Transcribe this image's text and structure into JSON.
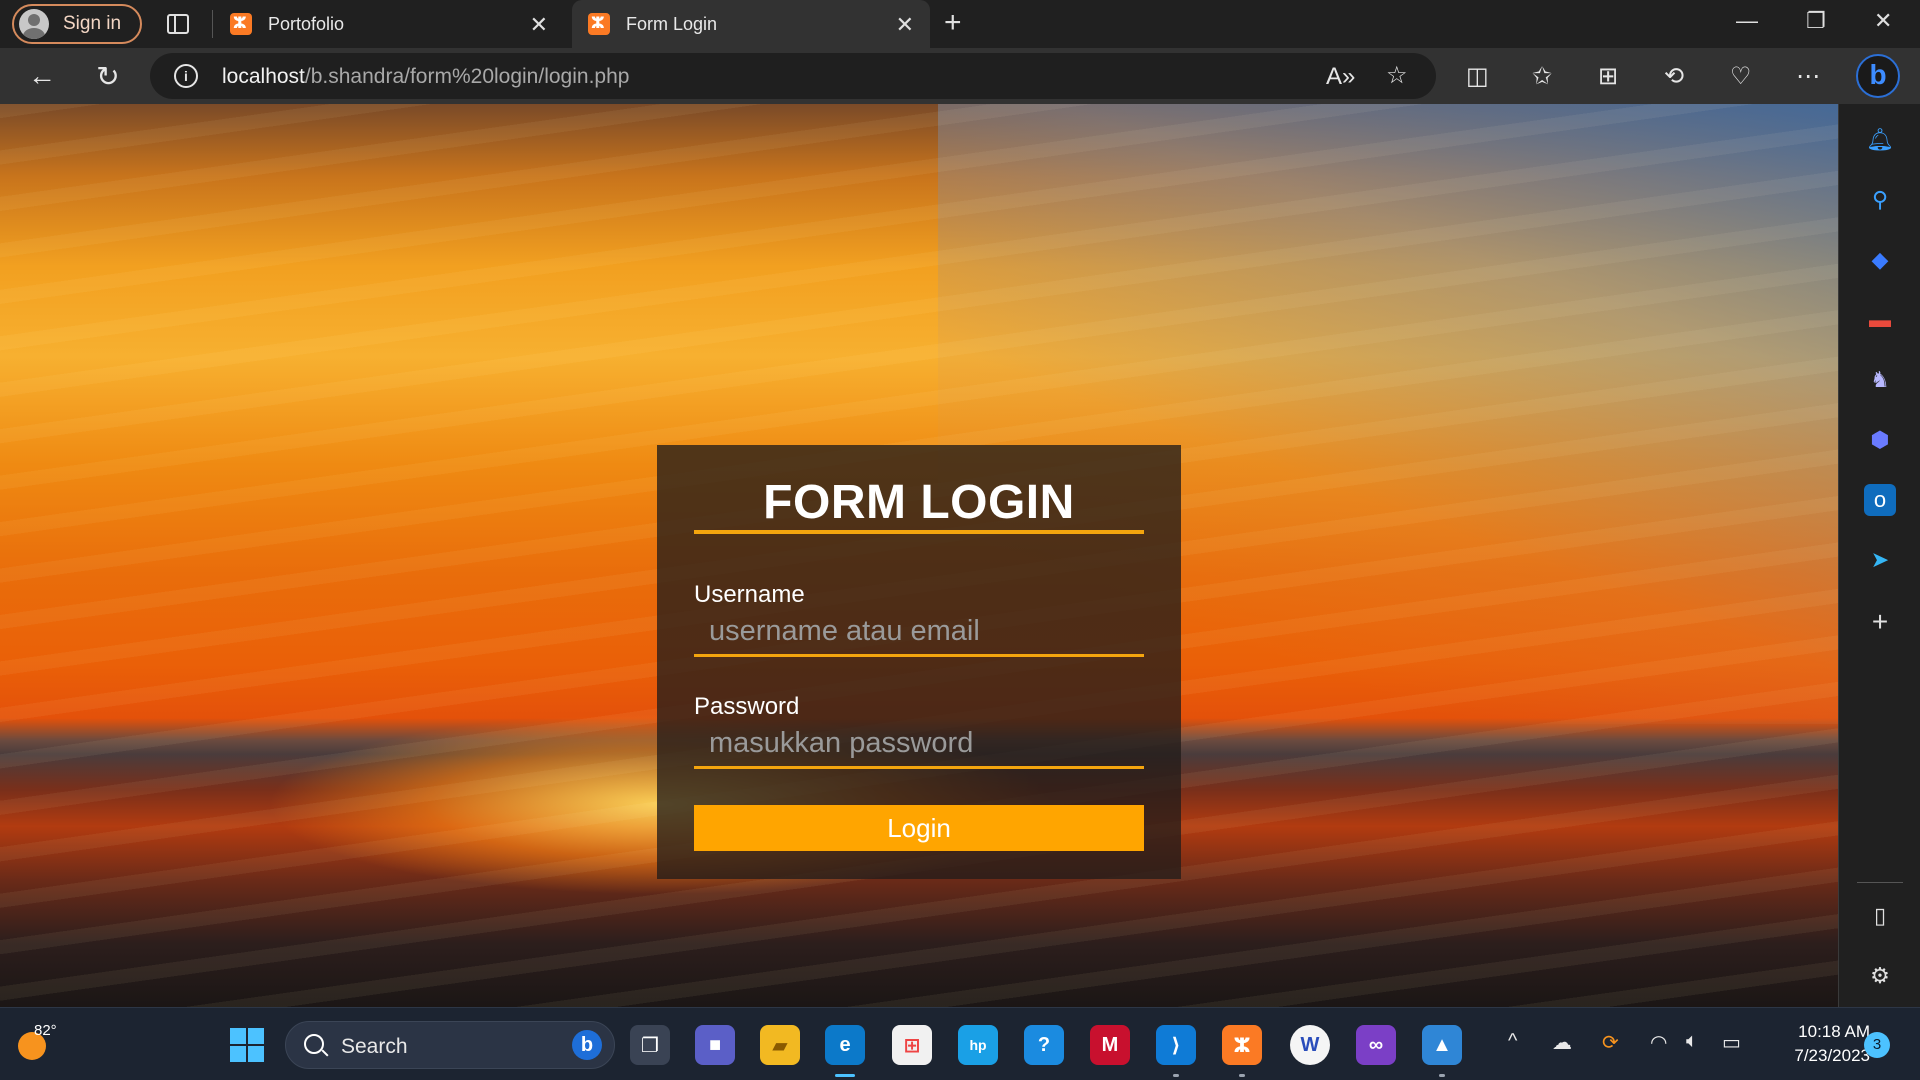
{
  "browser": {
    "profile_button": "Sign in",
    "tabs": [
      {
        "title": "Portofolio",
        "active": false
      },
      {
        "title": "Form Login",
        "active": true
      }
    ],
    "address": {
      "host": "localhost",
      "path": "/b.shandra/form%20login/login.php"
    }
  },
  "page": {
    "form": {
      "title": "FORM LOGIN",
      "username_label": "Username",
      "username_placeholder": "username atau email",
      "password_label": "Password",
      "password_placeholder": "masukkan password",
      "submit_label": "Login"
    }
  },
  "taskbar": {
    "weather_temp": "82°",
    "search_label": "Search",
    "time": "10:18 AM",
    "date": "7/23/2023",
    "notification_count": "3"
  },
  "colors": {
    "accent": "#ffa500",
    "card_bg": "rgba(35,28,25,0.78)",
    "taskbar_accent": "#4cc2ff"
  }
}
